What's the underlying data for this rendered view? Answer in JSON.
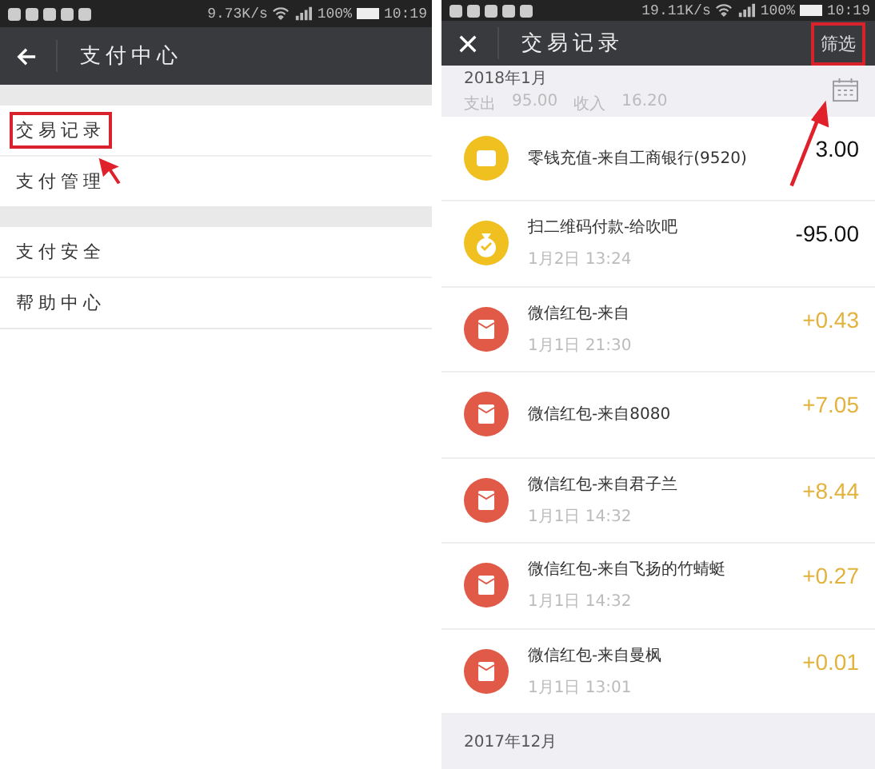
{
  "left": {
    "status_bar": {
      "speed": "9.73K/s",
      "battery": "100%",
      "time": "10:19"
    },
    "title": "支付中心",
    "groups": [
      [
        {
          "label": "交易记录",
          "highlighted": true
        },
        {
          "label": "支付管理",
          "highlighted": false
        }
      ],
      [
        {
          "label": "支付安全",
          "highlighted": false
        },
        {
          "label": "帮助中心",
          "highlighted": false
        }
      ]
    ]
  },
  "right": {
    "status_bar": {
      "speed": "19.11K/s",
      "battery": "100%",
      "time": "10:19"
    },
    "title": "交易记录",
    "filter": {
      "label": "筛选",
      "highlighted": true
    },
    "month": {
      "label": "2018年1月",
      "expense_label": "支出",
      "expense": "95.00",
      "income_label": "收入",
      "income": "16.20"
    },
    "transactions": [
      {
        "kind": "topup",
        "title": "零钱充值-来自工商银行(9520)",
        "amount": "3.00",
        "income": false
      },
      {
        "kind": "payment",
        "title": "扫二维码付款-给吹吧",
        "time": "1月2日 13:24",
        "amount": "-95.00",
        "income": false
      },
      {
        "kind": "gift",
        "title": "微信红包-来自",
        "time": "1月1日 21:30",
        "amount": "+0.43",
        "income": true
      },
      {
        "kind": "gift",
        "title": "微信红包-来自8080",
        "amount": "+7.05",
        "income": true
      },
      {
        "kind": "gift",
        "title": "微信红包-来自君子兰",
        "time": "1月1日 14:32",
        "amount": "+8.44",
        "income": true
      },
      {
        "kind": "gift",
        "title": "微信红包-来自飞扬的竹蜻蜓",
        "time": "1月1日 14:32",
        "amount": "+0.27",
        "income": true
      },
      {
        "kind": "gift",
        "title": "微信红包-来自曼枫",
        "time": "1月1日 13:01",
        "amount": "+0.01",
        "income": true
      }
    ],
    "next_month": "2017年12月"
  }
}
